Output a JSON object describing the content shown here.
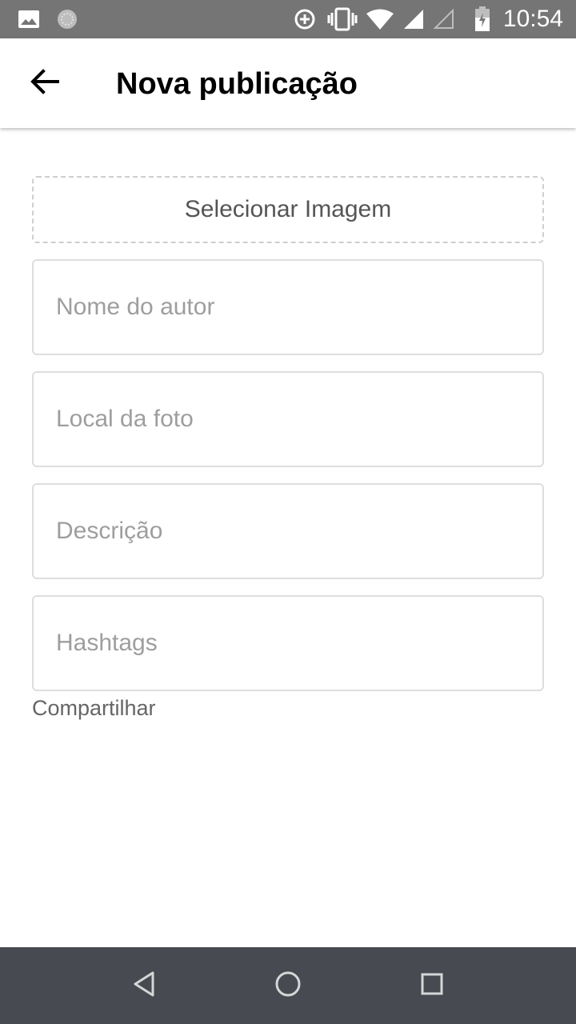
{
  "status_bar": {
    "time": "10:54",
    "icons": [
      "image-icon",
      "sync-icon",
      "data-saver-icon",
      "vibrate-icon",
      "wifi-icon",
      "signal-icon",
      "signal-empty-icon",
      "battery-icon"
    ]
  },
  "header": {
    "title": "Nova publicação",
    "back_icon": "arrow-back-icon"
  },
  "form": {
    "select_image_label": "Selecionar Imagem",
    "author": {
      "placeholder": "Nome do autor",
      "value": ""
    },
    "location": {
      "placeholder": "Local da foto",
      "value": ""
    },
    "description": {
      "placeholder": "Descrição",
      "value": ""
    },
    "hashtags": {
      "placeholder": "Hashtags",
      "value": ""
    },
    "share_label": "Compartilhar"
  },
  "nav_bar": {
    "icons": [
      "nav-back-icon",
      "nav-home-icon",
      "nav-recents-icon"
    ]
  },
  "colors": {
    "status_bar": "#757575",
    "nav_bar": "#474a50",
    "border": "#dedede",
    "placeholder": "#9e9e9e"
  }
}
